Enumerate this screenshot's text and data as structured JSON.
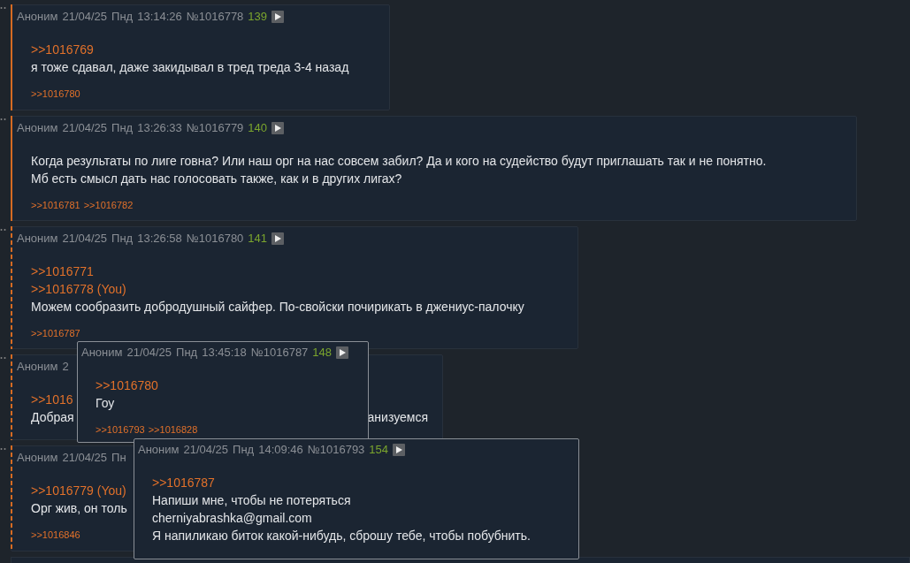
{
  "posts": [
    {
      "kind": "solid",
      "header": {
        "author": "Аноним",
        "date": "21/04/25",
        "day": "Пнд",
        "time": "13:14:26",
        "number": "№1016778",
        "count": "139"
      },
      "replies": [
        ">>1016769"
      ],
      "body": [
        {
          "text": "я тоже сдавал, даже закидывал в тред треда 3-4 назад"
        }
      ],
      "backlinks": [
        ">>1016780"
      ]
    },
    {
      "kind": "solid",
      "header": {
        "author": "Аноним",
        "date": "21/04/25",
        "day": "Пнд",
        "time": "13:26:33",
        "number": "№1016779",
        "count": "140"
      },
      "body": [
        {
          "text": "Когда результаты по лиге говна? Или наш орг на нас совсем забил? Да и кого на судейство будут приглашать так и не понятно."
        },
        {
          "text": "Мб есть смысл дать нас голосовать также, как и в других лигах?"
        }
      ],
      "backlinks": [
        ">>1016781",
        ">>1016782"
      ]
    },
    {
      "kind": "dashed",
      "header": {
        "author": "Аноним",
        "date": "21/04/25",
        "day": "Пнд",
        "time": "13:26:58",
        "number": "№1016780",
        "count": "141"
      },
      "replies": [
        ">>1016771",
        ">>1016778 (You)"
      ],
      "body": [
        {
          "text": "Можем сообразить добродушный сайфер. По-свойски почирикать в джениус-палочку"
        }
      ],
      "backlinks": [
        ">>1016787"
      ]
    },
    {
      "kind": "dashed",
      "header": {
        "author": "Аноним",
        "date": "2"
      },
      "replies": [
        ">>1016"
      ],
      "body": [
        {
          "text": "Добрая",
          "tail": "анизуемся"
        }
      ]
    },
    {
      "kind": "dashed",
      "header": {
        "author": "Аноним",
        "date": "21/04/25",
        "day": "Пн"
      },
      "replies": [
        ">>1016779 (You)"
      ],
      "body": [
        {
          "text": "Орг жив, он толь"
        }
      ],
      "backlinks": [
        ">>1016846"
      ]
    }
  ],
  "popups": [
    {
      "header": {
        "author": "Аноним",
        "date": "21/04/25",
        "day": "Пнд",
        "time": "13:45:18",
        "number": "№1016787",
        "count": "148"
      },
      "replies": [
        ">>1016780"
      ],
      "body": [
        {
          "text": "Гоу"
        }
      ],
      "backlinks": [
        ">>1016793",
        ">>1016828"
      ]
    },
    {
      "header": {
        "author": "Аноним",
        "date": "21/04/25",
        "day": "Пнд",
        "time": "14:09:46",
        "number": "№1016793",
        "count": "154"
      },
      "replies": [
        ">>1016787"
      ],
      "body": [
        {
          "text": "Напиши мне, чтобы не потеряться"
        },
        {
          "text": "cherniyabrashka@gmail.com"
        },
        {
          "text": "Я напиликаю биток какой-нибудь, сброшу тебе, чтобы побубнить."
        }
      ]
    }
  ]
}
